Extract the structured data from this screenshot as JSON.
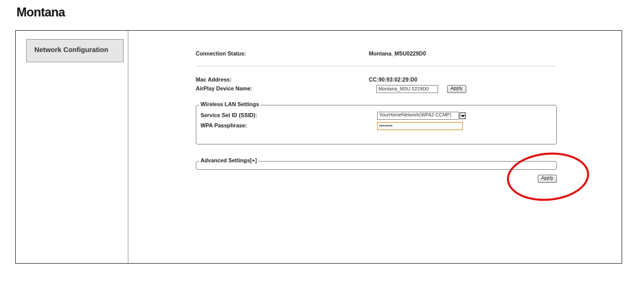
{
  "app_title": "Montana",
  "sidebar": {
    "items": [
      {
        "label": "Network Configuration"
      }
    ]
  },
  "status": {
    "label": "Connection Status:",
    "value": "Montana_MSU0229D0"
  },
  "mac": {
    "label": "Mac Address:",
    "value": "CC:90:93:02:29:D0"
  },
  "device_name": {
    "label": "AirPlay Device Name:",
    "value": "Montana_MSU 0229D0",
    "apply_label": "Apply"
  },
  "wireless": {
    "legend": "Wireless LAN Settings",
    "ssid_label": "Service Set ID (SSID):",
    "ssid_value": "YourHomeNetwork(WPA2 CCMP)",
    "pass_label": "WPA Passphrase:",
    "pass_value": "••••••••"
  },
  "advanced": {
    "legend": "Advanced Settings[+]"
  },
  "apply_button": "Apply",
  "colors": {
    "highlight": "#e01010",
    "focus_border": "#e0a040"
  }
}
